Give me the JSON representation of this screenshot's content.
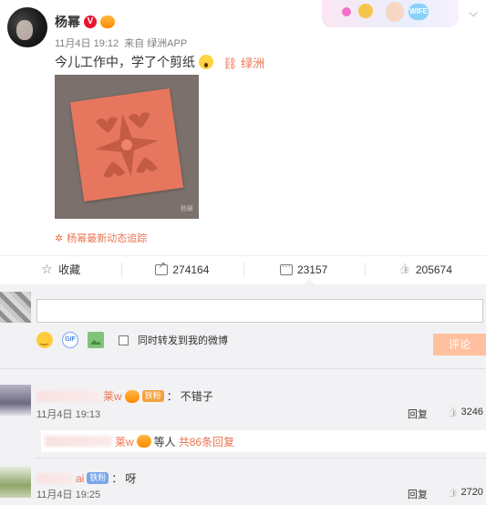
{
  "post": {
    "author": "杨幂",
    "time": "11月4日 19:12",
    "source_prefix": "来自",
    "source": "绿洲APP",
    "text": "今儿工作中，学了个剪纸",
    "location_label": "绿洲",
    "photo_signature": "杨幂",
    "follow_link": "杨幂最新动态追踪"
  },
  "actions": {
    "favorite": "收藏",
    "forward_count": "274164",
    "comment_count": "23157",
    "like_count": "205674"
  },
  "compose": {
    "input_value": "",
    "repost_label": "同时转发到我的微博",
    "submit_label": "评论"
  },
  "comments": [
    {
      "name_suffix": "莱w",
      "text_prefix": "：",
      "text": "不错子",
      "time": "11月4日 19:13",
      "reply_label": "回复",
      "likes": "3246"
    },
    {
      "name_suffix": "ai",
      "text_prefix": "：",
      "text": "呀",
      "badge": "铁粉",
      "time": "11月4日 19:25",
      "reply_label": "回复",
      "likes": "2720"
    }
  ],
  "sub_reply": {
    "name_suffix": "莱w",
    "middle": "等人",
    "count_text": "共86条回复"
  },
  "colors": {
    "accent": "#eb7350",
    "submit_bg": "#ffc09f",
    "comment_bg": "#f2f2f5"
  }
}
